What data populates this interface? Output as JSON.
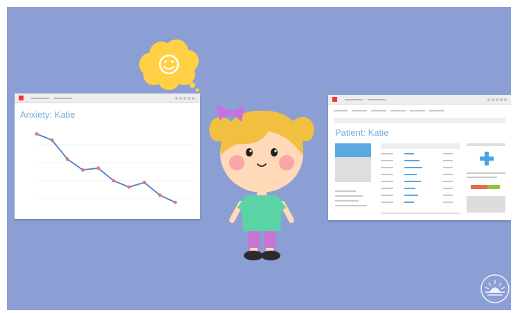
{
  "colors": {
    "scene_background": "#8b9fd4",
    "window_accent": "#ff3030",
    "title_blue": "#74aee0",
    "chart_line": "#5b86c7",
    "chart_point": "#e0758c",
    "bubble": "#ffd044",
    "hair": "#f2c040",
    "shirt": "#5cd3a4",
    "pants": "#c774d4",
    "bow": "#c96fde"
  },
  "left_window": {
    "title": "Anxiety: Katie"
  },
  "chart_data": {
    "type": "line",
    "title": "Anxiety: Katie",
    "xlabel": "",
    "ylabel": "",
    "grid": true,
    "x": [
      1,
      2,
      3,
      4,
      5,
      6,
      7,
      8,
      9,
      10
    ],
    "values": [
      9.2,
      8.5,
      6.4,
      5.2,
      5.4,
      4.0,
      3.3,
      3.8,
      2.4,
      1.6
    ],
    "ylim": [
      0,
      10
    ]
  },
  "right_window": {
    "title": "Patient: Katie"
  },
  "thought_bubble": {
    "icon": "smiley-face-icon"
  },
  "character": {
    "icon": "girl-character"
  },
  "watermark": {
    "icon": "sunrise-logo-icon"
  }
}
